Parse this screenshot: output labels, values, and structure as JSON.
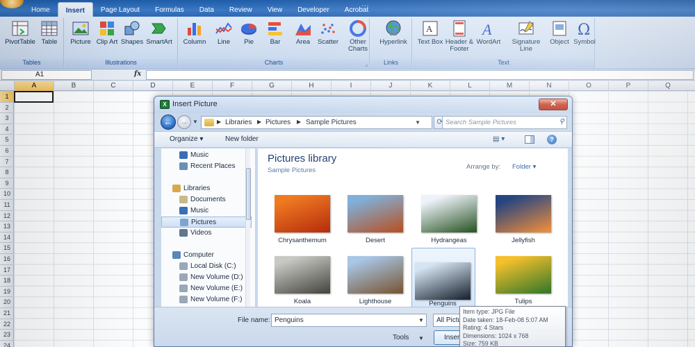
{
  "window": {
    "title": "…"
  },
  "ribbon": {
    "tabs": [
      {
        "label": "Home",
        "active": false
      },
      {
        "label": "Insert",
        "active": true
      },
      {
        "label": "Page Layout",
        "active": false
      },
      {
        "label": "Formulas",
        "active": false
      },
      {
        "label": "Data",
        "active": false
      },
      {
        "label": "Review",
        "active": false
      },
      {
        "label": "View",
        "active": false
      },
      {
        "label": "Developer",
        "active": false
      },
      {
        "label": "Acrobat",
        "active": false
      }
    ],
    "groups": [
      {
        "label": "Tables",
        "buttons": [
          {
            "label": "PivotTable",
            "icon": "pivottable-icon"
          },
          {
            "label": "Table",
            "icon": "table-icon"
          }
        ]
      },
      {
        "label": "Illustrations",
        "buttons": [
          {
            "label": "Picture",
            "icon": "picture-icon"
          },
          {
            "label": "Clip Art",
            "icon": "clip-art-icon"
          },
          {
            "label": "Shapes",
            "icon": "shapes-icon"
          },
          {
            "label": "SmartArt",
            "icon": "smartart-icon"
          }
        ]
      },
      {
        "label": "Charts",
        "buttons": [
          {
            "label": "Column",
            "icon": "column-chart-icon"
          },
          {
            "label": "Line",
            "icon": "line-chart-icon"
          },
          {
            "label": "Pie",
            "icon": "pie-chart-icon"
          },
          {
            "label": "Bar",
            "icon": "bar-chart-icon"
          },
          {
            "label": "Area",
            "icon": "area-chart-icon"
          },
          {
            "label": "Scatter",
            "icon": "scatter-chart-icon"
          },
          {
            "label": "Other Charts",
            "icon": "other-charts-icon"
          }
        ]
      },
      {
        "label": "Links",
        "buttons": [
          {
            "label": "Hyperlink",
            "icon": "hyperlink-icon"
          }
        ]
      },
      {
        "label": "Text",
        "buttons": [
          {
            "label": "Text Box",
            "icon": "text-box-icon"
          },
          {
            "label": "Header & Footer",
            "icon": "header-footer-icon"
          },
          {
            "label": "WordArt",
            "icon": "wordart-icon"
          },
          {
            "label": "Signature Line",
            "icon": "signature-line-icon"
          },
          {
            "label": "Object",
            "icon": "object-icon"
          },
          {
            "label": "Symbol",
            "icon": "symbol-icon"
          }
        ]
      }
    ]
  },
  "formula_bar": {
    "name_box": "A1",
    "fx": "fx",
    "formula": ""
  },
  "grid": {
    "columns": [
      "A",
      "B",
      "C",
      "D",
      "E",
      "F",
      "G",
      "H",
      "I",
      "J",
      "K",
      "L",
      "M",
      "N",
      "O",
      "P",
      "Q"
    ],
    "rows": [
      "1",
      "2",
      "3",
      "4",
      "5",
      "6",
      "7",
      "8",
      "9",
      "10",
      "11",
      "12",
      "13",
      "14",
      "15",
      "16",
      "17",
      "18",
      "19",
      "20",
      "21",
      "22",
      "23",
      "24"
    ],
    "active_cell": "A1"
  },
  "dialog": {
    "title": "Insert Picture",
    "close_label": "✕",
    "breadcrumbs": [
      "Libraries",
      "Pictures",
      "Sample Pictures"
    ],
    "search_placeholder": "Search Sample Pictures",
    "toolbar": {
      "organize": "Organize ▾",
      "new_folder": "New folder",
      "views": "▤ ▾",
      "help": "?"
    },
    "nav_items": [
      {
        "label": "Music",
        "icon": "music-icon",
        "indent": 1,
        "color": "#3a6fb8"
      },
      {
        "label": "Recent Places",
        "icon": "recent-places-icon",
        "indent": 1,
        "color": "#6b8fb6"
      },
      {
        "label": "Libraries",
        "icon": "libraries-icon",
        "indent": 0,
        "color": "#d9a84a"
      },
      {
        "label": "Documents",
        "icon": "documents-icon",
        "indent": 1,
        "color": "#c9b98a"
      },
      {
        "label": "Music",
        "icon": "music-icon",
        "indent": 1,
        "color": "#3a6fb8"
      },
      {
        "label": "Pictures",
        "icon": "pictures-icon",
        "indent": 1,
        "color": "#7da5cf",
        "selected": true
      },
      {
        "label": "Videos",
        "icon": "videos-icon",
        "indent": 1,
        "color": "#5f7791"
      },
      {
        "label": "Computer",
        "icon": "computer-icon",
        "indent": 0,
        "color": "#5b86b8"
      },
      {
        "label": "Local Disk (C:)",
        "icon": "drive-icon",
        "indent": 1,
        "color": "#9aa7b6"
      },
      {
        "label": "New Volume (D:)",
        "icon": "drive-icon",
        "indent": 1,
        "color": "#9aa7b6"
      },
      {
        "label": "New Volume (E:)",
        "icon": "drive-icon",
        "indent": 1,
        "color": "#9aa7b6"
      },
      {
        "label": "New Volume (F:)",
        "icon": "drive-icon",
        "indent": 1,
        "color": "#9aa7b6"
      }
    ],
    "library_title": "Pictures library",
    "library_subtitle": "Sample Pictures",
    "arrange_label": "Arrange by:",
    "arrange_value": "Folder ▾",
    "pictures": [
      {
        "name": "Chrysanthemum",
        "colors": [
          "#f07a22",
          "#b8300d"
        ]
      },
      {
        "name": "Desert",
        "colors": [
          "#7fb0da",
          "#b4542a"
        ]
      },
      {
        "name": "Hydrangeas",
        "colors": [
          "#eef2fb",
          "#2f5a2a"
        ]
      },
      {
        "name": "Jellyfish",
        "colors": [
          "#1a3b7a",
          "#e98a3a"
        ]
      },
      {
        "name": "Koala",
        "colors": [
          "#c8c9c4",
          "#4b4a44"
        ]
      },
      {
        "name": "Lighthouse",
        "colors": [
          "#a8c6e6",
          "#7a5a3a"
        ]
      },
      {
        "name": "Penguins",
        "colors": [
          "#d5e4f2",
          "#202a36"
        ],
        "selected": true
      },
      {
        "name": "Tulips",
        "colors": [
          "#f5c02c",
          "#3b7a2a"
        ]
      }
    ],
    "tooltip": [
      "Item type: JPG File",
      "Date taken: 18-Feb-08 5:07 AM",
      "Rating: 4 Stars",
      "Dimensions: 1024 x 768",
      "Size: 759 KB"
    ],
    "file_name_label": "File name:",
    "file_name_value": "Penguins",
    "file_type_value": "All Pictu",
    "tools_label": "Tools",
    "insert_label": "Insert"
  }
}
